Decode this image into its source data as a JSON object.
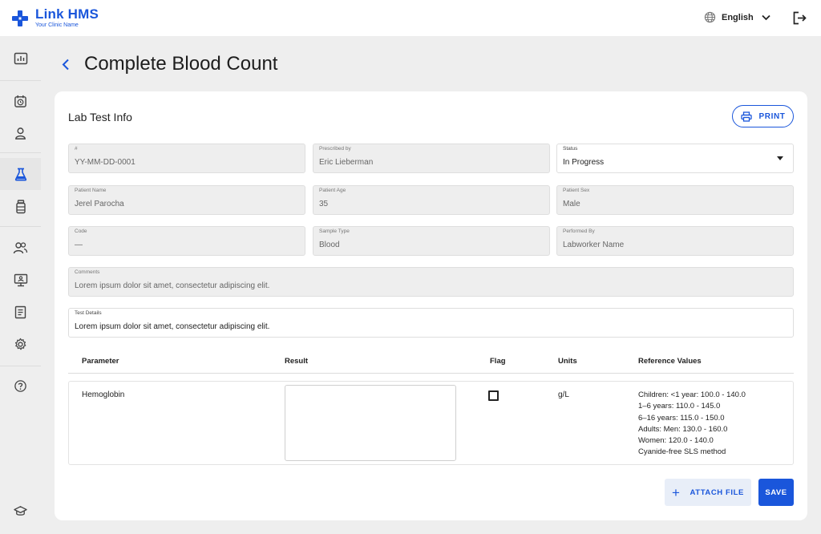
{
  "brand": {
    "name": "Link HMS",
    "subtitle": "Your Clinic Name",
    "accent": "#1a56db"
  },
  "header": {
    "language": "English",
    "language_icon": "globe-icon",
    "logout_icon": "logout-icon"
  },
  "sidebar": {
    "items": [
      {
        "name": "dashboard",
        "icon": "chart-icon"
      },
      {
        "name": "appointments",
        "icon": "alarm-clock-icon"
      },
      {
        "name": "patients",
        "icon": "person-icon"
      },
      {
        "name": "lab-tests",
        "icon": "flask-icon",
        "active": true
      },
      {
        "name": "pharmacy",
        "icon": "bottle-icon"
      },
      {
        "name": "staff",
        "icon": "users-icon"
      },
      {
        "name": "monitor",
        "icon": "monitor-icon"
      },
      {
        "name": "reports",
        "icon": "document-icon"
      },
      {
        "name": "settings",
        "icon": "gear-icon"
      },
      {
        "name": "help",
        "icon": "help-icon"
      },
      {
        "name": "education",
        "icon": "graduation-cap-icon"
      }
    ]
  },
  "page": {
    "title": "Complete Blood Count"
  },
  "card": {
    "title": "Lab Test Info",
    "print_label": "PRINT",
    "fields": {
      "number": {
        "label": "#",
        "value": "YY-MM-DD-0001"
      },
      "prescribed_by": {
        "label": "Prescribed by",
        "value": "Eric Lieberman"
      },
      "status": {
        "label": "Status",
        "value": "In Progress"
      },
      "patient_name": {
        "label": "Patient Name",
        "value": "Jerel Parocha"
      },
      "patient_age": {
        "label": "Patient Age",
        "value": "35"
      },
      "patient_sex": {
        "label": "Patient Sex",
        "value": "Male"
      },
      "code": {
        "label": "Code",
        "value": "—"
      },
      "sample_type": {
        "label": "Sample Type",
        "value": "Blood"
      },
      "performed_by": {
        "label": "Performed By",
        "value": "Labworker Name"
      },
      "comments": {
        "label": "Comments",
        "value": "Lorem ipsum dolor sit amet, consectetur adipiscing elit."
      },
      "test_details": {
        "label": "Test Details",
        "value": "Lorem ipsum dolor sit amet, consectetur adipiscing elit."
      }
    },
    "table": {
      "columns": [
        "Parameter",
        "Result",
        "Flag",
        "Units",
        "Reference Values"
      ],
      "rows": [
        {
          "parameter": "Hemoglobin",
          "result": "",
          "flag": false,
          "units": "g/L",
          "reference": [
            "Children: <1 year: 100.0 - 140.0",
            "1–6 years: 110.0 - 145.0",
            "6–16 years: 115.0 - 150.0",
            "Adults: Men: 130.0 - 160.0",
            "Women: 120.0 - 140.0",
            "Cyanide-free SLS method"
          ]
        }
      ]
    },
    "attach_label": "ATTACH FILE",
    "save_label": "SAVE"
  }
}
